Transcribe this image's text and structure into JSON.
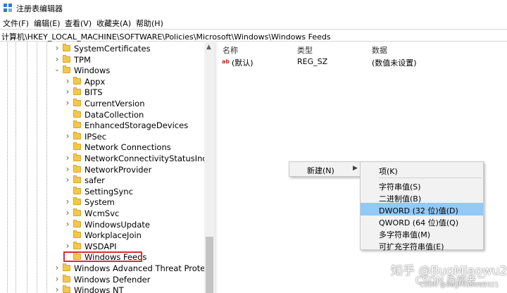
{
  "window": {
    "title": "注册表编辑器",
    "app_icon": "regedit-icon"
  },
  "menu": [
    "文件(F)",
    "编辑(E)",
    "查看(V)",
    "收藏夹(A)",
    "帮助(H)"
  ],
  "address": "计算机\\HKEY_LOCAL_MACHINE\\SOFTWARE\\Policies\\Microsoft\\Windows\\Windows Feeds",
  "tree": {
    "items": [
      {
        "label": "SystemCertificates",
        "expander": "collapsed"
      },
      {
        "label": "TPM",
        "expander": "collapsed"
      },
      {
        "label": "Windows",
        "expander": "expanded"
      },
      {
        "label": "Appx",
        "expander": "collapsed"
      },
      {
        "label": "BITS",
        "expander": "collapsed"
      },
      {
        "label": "CurrentVersion",
        "expander": "collapsed"
      },
      {
        "label": "DataCollection",
        "expander": "none"
      },
      {
        "label": "EnhancedStorageDevices",
        "expander": "none"
      },
      {
        "label": "IPSec",
        "expander": "collapsed"
      },
      {
        "label": "Network Connections",
        "expander": "none"
      },
      {
        "label": "NetworkConnectivityStatusIndica",
        "expander": "collapsed"
      },
      {
        "label": "NetworkProvider",
        "expander": "collapsed"
      },
      {
        "label": "safer",
        "expander": "collapsed"
      },
      {
        "label": "SettingSync",
        "expander": "none"
      },
      {
        "label": "System",
        "expander": "collapsed"
      },
      {
        "label": "WcmSvc",
        "expander": "collapsed"
      },
      {
        "label": "WindowsUpdate",
        "expander": "collapsed"
      },
      {
        "label": "WorkplaceJoin",
        "expander": "none"
      },
      {
        "label": "WSDAPI",
        "expander": "collapsed"
      },
      {
        "label": "Windows Feeds",
        "expander": "none",
        "highlighted": true
      },
      {
        "label": "Windows Advanced Threat Protectio",
        "expander": "collapsed"
      },
      {
        "label": "Windows Defender",
        "expander": "collapsed"
      },
      {
        "label": "Windows NT",
        "expander": "collapsed"
      }
    ]
  },
  "values_pane": {
    "columns": [
      "名称",
      "类型",
      "数据"
    ],
    "rows": [
      {
        "name": "(默认)",
        "type": "REG_SZ",
        "data": "(数值未设置)",
        "icon": "string-value-icon"
      }
    ]
  },
  "context_menu": {
    "new_label": "新建(N)",
    "arrow": "▶"
  },
  "submenu": {
    "items": [
      {
        "label": "项(K)"
      },
      {
        "label": "字符串值(S)"
      },
      {
        "label": "二进制值(B)"
      },
      {
        "label": "DWORD (32 位)值(D)",
        "selected": true
      },
      {
        "label": "QWORD (64 位)值(Q)"
      },
      {
        "label": "多字符串值(M)"
      },
      {
        "label": "可扩充字符串值(E)"
      }
    ]
  },
  "watermarks": {
    "zhihu": "知乎 @BugMiaowu2021",
    "csdn": "CSDN @郭老二",
    "csdn_small": "CSDN @BugMiaowu2021"
  },
  "colors": {
    "highlight_border": "#d93030",
    "submenu_selected": "#91c9f7",
    "folder": "#f3c74f"
  }
}
